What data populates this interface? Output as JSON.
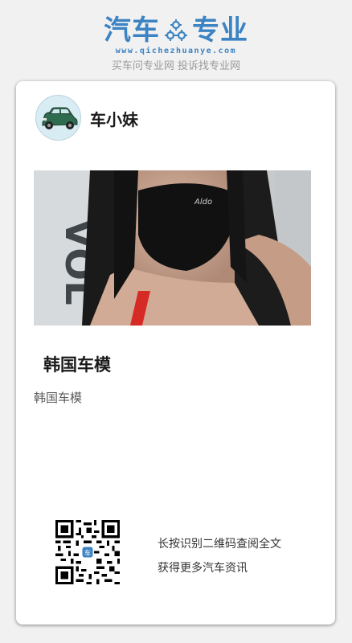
{
  "header": {
    "logo_left": "汽车",
    "logo_right": "专业",
    "url": "www.qichezhuanye.com",
    "tagline": "买车问专业网 投诉找专业网"
  },
  "author": {
    "name": "车小妹"
  },
  "article": {
    "title": "韩国车模",
    "description": "韩国车模"
  },
  "qr": {
    "line1": "长按识别二维码查阅全文",
    "line2": "获得更多汽车资讯"
  },
  "colors": {
    "brand": "#3b83c2",
    "background": "#f1f1f1",
    "card": "#ffffff"
  }
}
